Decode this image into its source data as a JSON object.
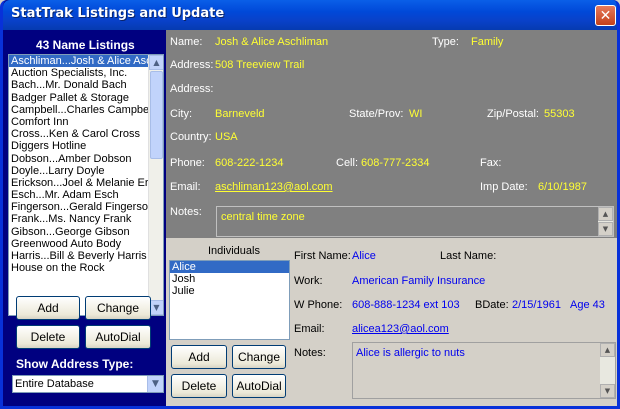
{
  "window": {
    "title": "StatTrak Listings and Update",
    "close_glyph": "✕"
  },
  "listings": {
    "header": "43 Name Listings",
    "items": [
      "Aschliman...Josh & Alice Aschliman",
      "Auction Specialists, Inc.",
      "Bach...Mr. Donald Bach",
      "Badger Pallet & Storage",
      "Campbell...Charles Campbell",
      "Comfort Inn",
      "Cross...Ken & Carol Cross",
      "Diggers Hotline",
      "Dobson...Amber Dobson",
      "Doyle...Larry Doyle",
      "Erickson...Joel & Melanie Erickson",
      "Esch...Mr. Adam Esch",
      "Fingerson...Gerald Fingerson",
      "Frank...Ms. Nancy Frank",
      "Gibson...George Gibson",
      "Greenwood Auto Body",
      "Harris...Bill & Beverly Harris",
      "House on the Rock"
    ],
    "selected_index": 0
  },
  "left_buttons": {
    "add": "Add",
    "change": "Change",
    "delete": "Delete",
    "autodial": "AutoDial"
  },
  "address_type": {
    "label": "Show Address Type:",
    "selected": "Entire Database"
  },
  "record": {
    "name_label": "Name:",
    "name": "Josh & Alice Aschliman",
    "type_label": "Type:",
    "type": "Family",
    "address_label": "Address:",
    "address1": "508 Treeview Trail",
    "address2_label": "Address:",
    "address2": "",
    "city_label": "City:",
    "city": "Barneveld",
    "state_label": "State/Prov:",
    "state": "WI",
    "zip_label": "Zip/Postal:",
    "zip": "55303",
    "country_label": "Country:",
    "country": "USA",
    "phone_label": "Phone:",
    "phone": "608-222-1234",
    "cell_label": "Cell:",
    "cell": "608-777-2334",
    "fax_label": "Fax:",
    "fax": "",
    "email_label": "Email:",
    "email": "aschliman123@aol.com",
    "impdate_label": "Imp Date:",
    "impdate": "6/10/1987",
    "notes_label": "Notes:",
    "notes": "central time zone"
  },
  "individuals": {
    "header": "Individuals",
    "items": [
      "Alice",
      "Josh",
      "Julie"
    ],
    "selected_index": 0,
    "buttons": {
      "add": "Add",
      "change": "Change",
      "delete": "Delete",
      "autodial": "AutoDial"
    }
  },
  "person": {
    "first_label": "First Name:",
    "first": "Alice",
    "last_label": "Last Name:",
    "last": "",
    "work_label": "Work:",
    "work": "American Family Insurance",
    "wphone_label": "W Phone:",
    "wphone": "608-888-1234 ext 103",
    "bdate_label": "BDate:",
    "bdate": "2/15/1961",
    "age": "Age 43",
    "email_label": "Email:",
    "email": "alicea123@aol.com",
    "notes_label": "Notes:",
    "notes": "Alice is allergic to nuts"
  }
}
